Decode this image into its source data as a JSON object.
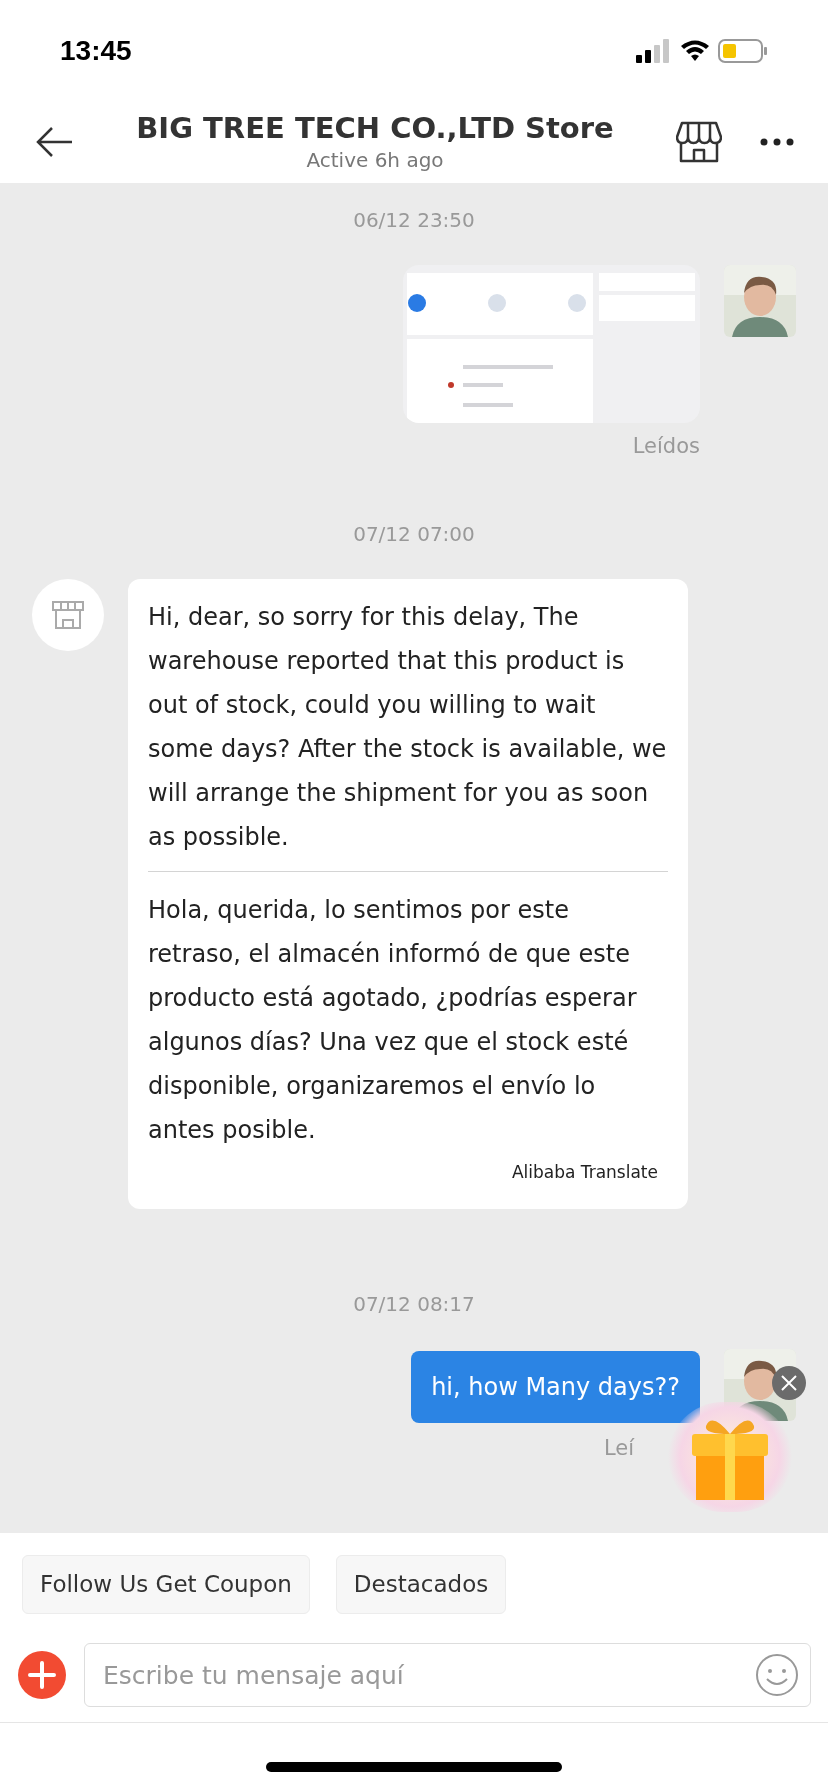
{
  "status_bar": {
    "time": "13:45"
  },
  "header": {
    "title": "BIG TREE TECH CO.,LTD Store",
    "subtitle": "Active 6h ago"
  },
  "messages": [
    {
      "kind": "timestamp",
      "text": "06/12 23:50"
    },
    {
      "kind": "image_sent",
      "status": "Leídos"
    },
    {
      "kind": "timestamp",
      "text": "07/12 07:00"
    },
    {
      "kind": "text_received",
      "text": "Hi, dear, so sorry for this delay, The warehouse reported that this product is out of stock, could you willing to wait some days? After the stock is available, we will arrange the shipment for you as soon as possible.",
      "translation": "Hola, querida, lo sentimos por este retraso, el almacén informó de que este producto está agotado, ¿podrías esperar algunos días? Una vez que el stock esté disponible, organizaremos el envío lo antes posible.",
      "translator": "Alibaba Translate"
    },
    {
      "kind": "timestamp",
      "text": "07/12 08:17"
    },
    {
      "kind": "text_sent",
      "text": "hi, how Many days??",
      "status": "Leí"
    }
  ],
  "quick_replies": [
    "Follow Us Get Coupon",
    "Destacados"
  ],
  "composer": {
    "placeholder": "Escribe tu mensaje aquí"
  }
}
